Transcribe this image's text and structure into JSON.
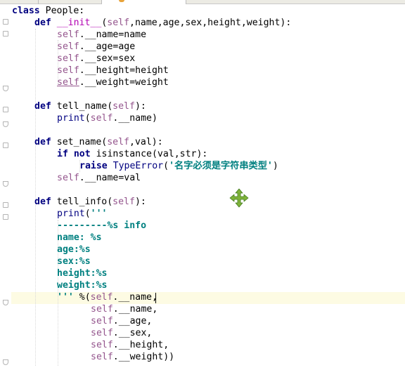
{
  "tabs": [
    "",
    "",
    ""
  ],
  "icons": {
    "tab_file": "python-file-icon",
    "fold": "fold-marker-icon",
    "cursor": "move-cursor-icon"
  },
  "colors": {
    "keyword": "#000080",
    "self": "#94558d",
    "string": "#008080",
    "magic": "#b200b2",
    "current_line": "#fdfbe3",
    "cursor": "#7fb23a"
  },
  "lines": [
    {
      "indent": 0,
      "tokens": [
        {
          "t": "class",
          "c": "kw"
        },
        {
          "t": " People:"
        }
      ]
    },
    {
      "indent": 4,
      "tokens": [
        {
          "t": "def",
          "c": "kw"
        },
        {
          "t": " "
        },
        {
          "t": "__init__",
          "c": "fn"
        },
        {
          "t": "("
        },
        {
          "t": "self",
          "c": "self"
        },
        {
          "t": ",name,age,sex,height,weight):"
        }
      ]
    },
    {
      "indent": 8,
      "tokens": [
        {
          "t": "self",
          "c": "self"
        },
        {
          "t": ".__name=name"
        }
      ]
    },
    {
      "indent": 8,
      "tokens": [
        {
          "t": "self",
          "c": "self"
        },
        {
          "t": ".__age=age"
        }
      ]
    },
    {
      "indent": 8,
      "tokens": [
        {
          "t": "self",
          "c": "self"
        },
        {
          "t": ".__sex=sex"
        }
      ]
    },
    {
      "indent": 8,
      "tokens": [
        {
          "t": "self",
          "c": "self"
        },
        {
          "t": ".__height=height"
        }
      ]
    },
    {
      "indent": 8,
      "tokens": [
        {
          "t": "self",
          "c": "self u"
        },
        {
          "t": ".__weight=weight"
        }
      ]
    },
    {
      "indent": 0,
      "tokens": []
    },
    {
      "indent": 4,
      "tokens": [
        {
          "t": "def",
          "c": "kw"
        },
        {
          "t": " tell_name("
        },
        {
          "t": "self",
          "c": "self"
        },
        {
          "t": "):"
        }
      ]
    },
    {
      "indent": 8,
      "tokens": [
        {
          "t": "print",
          "c": "bi"
        },
        {
          "t": "("
        },
        {
          "t": "self",
          "c": "self"
        },
        {
          "t": ".__name)"
        }
      ]
    },
    {
      "indent": 0,
      "tokens": []
    },
    {
      "indent": 4,
      "tokens": [
        {
          "t": "def",
          "c": "kw"
        },
        {
          "t": " set_name("
        },
        {
          "t": "self",
          "c": "self"
        },
        {
          "t": ",val):"
        }
      ]
    },
    {
      "indent": 8,
      "tokens": [
        {
          "t": "if not",
          "c": "kw"
        },
        {
          "t": " isinstance(val,str):"
        }
      ]
    },
    {
      "indent": 12,
      "tokens": [
        {
          "t": "raise",
          "c": "kw"
        },
        {
          "t": " "
        },
        {
          "t": "TypeError",
          "c": "bi"
        },
        {
          "t": "("
        },
        {
          "t": "'名字必须是字符串类型'",
          "c": "str"
        },
        {
          "t": ")"
        }
      ]
    },
    {
      "indent": 8,
      "tokens": [
        {
          "t": "self",
          "c": "self"
        },
        {
          "t": ".__name=val"
        }
      ]
    },
    {
      "indent": 0,
      "tokens": []
    },
    {
      "indent": 4,
      "tokens": [
        {
          "t": "def",
          "c": "kw"
        },
        {
          "t": " tell_info("
        },
        {
          "t": "self",
          "c": "self"
        },
        {
          "t": "):"
        }
      ]
    },
    {
      "indent": 8,
      "tokens": [
        {
          "t": "print",
          "c": "bi"
        },
        {
          "t": "("
        },
        {
          "t": "'''",
          "c": "str"
        }
      ]
    },
    {
      "indent": 8,
      "tokens": [
        {
          "t": "---------%s info",
          "c": "str"
        }
      ]
    },
    {
      "indent": 8,
      "tokens": [
        {
          "t": "name: %s",
          "c": "str"
        }
      ]
    },
    {
      "indent": 8,
      "tokens": [
        {
          "t": "age:%s",
          "c": "str"
        }
      ]
    },
    {
      "indent": 8,
      "tokens": [
        {
          "t": "sex:%s",
          "c": "str"
        }
      ]
    },
    {
      "indent": 8,
      "tokens": [
        {
          "t": "height:%s",
          "c": "str"
        }
      ]
    },
    {
      "indent": 8,
      "tokens": [
        {
          "t": "weight:%s",
          "c": "str"
        }
      ]
    },
    {
      "indent": 8,
      "tokens": [
        {
          "t": "'''",
          "c": "str"
        },
        {
          "t": " %("
        },
        {
          "t": "self",
          "c": "self"
        },
        {
          "t": ".__name,"
        }
      ]
    },
    {
      "indent": 14,
      "tokens": [
        {
          "t": "self",
          "c": "self"
        },
        {
          "t": ".__name,"
        }
      ]
    },
    {
      "indent": 14,
      "tokens": [
        {
          "t": "self",
          "c": "self"
        },
        {
          "t": ".__age,"
        }
      ]
    },
    {
      "indent": 14,
      "tokens": [
        {
          "t": "self",
          "c": "self"
        },
        {
          "t": ".__sex,"
        }
      ]
    },
    {
      "indent": 14,
      "tokens": [
        {
          "t": "self",
          "c": "self"
        },
        {
          "t": ".__height,"
        }
      ]
    },
    {
      "indent": 14,
      "tokens": [
        {
          "t": "self",
          "c": "self"
        },
        {
          "t": ".__weight))"
        }
      ]
    }
  ]
}
